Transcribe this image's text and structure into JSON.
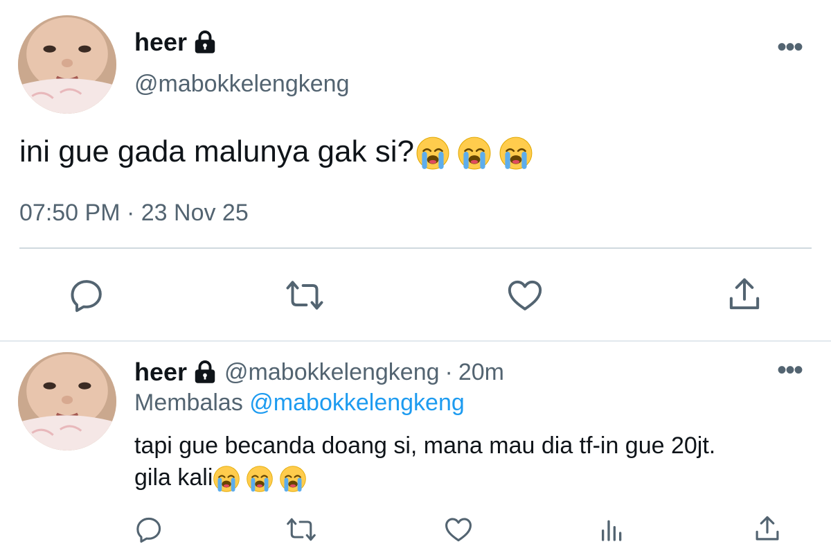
{
  "main_tweet": {
    "display_name": "heer",
    "handle": "@mabokkelengkeng",
    "text": "ini gue gada malunya gak si?",
    "emoji_name": "loudly-crying-face",
    "emoji_count": 3,
    "timestamp": "07:50 PM · 23 Nov 25"
  },
  "reply_tweet": {
    "display_name": "heer",
    "handle": "@mabokkelengkeng",
    "separator": "·",
    "time_ago": "20m",
    "replying_prefix": "Membalas",
    "replying_to": "@mabokkelengkeng",
    "text_line1": "tapi gue becanda doang si, mana mau dia tf-in gue 20jt.",
    "text_line2": "gila kali"
  },
  "icons": [
    "lock-icon",
    "more-icon",
    "reply-icon",
    "retweet-icon",
    "like-icon",
    "share-icon",
    "analytics-icon"
  ],
  "colors": {
    "text": "#0f1419",
    "secondary": "#536471",
    "link": "#1d9bf0",
    "divider": "#cfd9de"
  }
}
